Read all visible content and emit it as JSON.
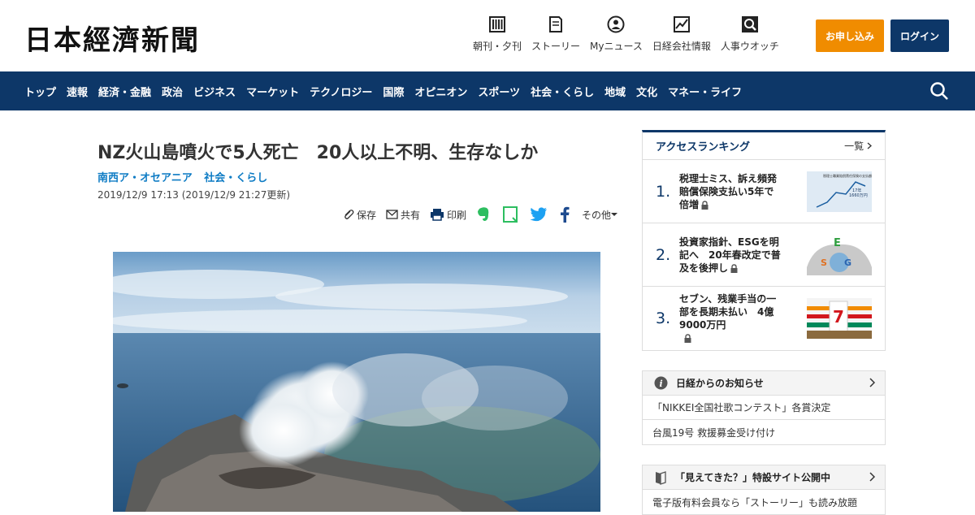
{
  "header": {
    "logo": "日本經濟新聞",
    "nav": [
      {
        "label": "朝刊・夕刊",
        "icon": "newspaper-icon"
      },
      {
        "label": "ストーリー",
        "icon": "book-icon"
      },
      {
        "label": "Myニュース",
        "icon": "user-icon"
      },
      {
        "label": "日経会社情報",
        "icon": "chart-icon"
      },
      {
        "label": "人事ウオッチ",
        "icon": "search-person-icon"
      }
    ],
    "apply_label": "お申し込み",
    "login_label": "ログイン"
  },
  "categories": [
    "トップ",
    "速報",
    "経済・金融",
    "政治",
    "ビジネス",
    "マーケット",
    "テクノロジー",
    "国際",
    "オピニオン",
    "スポーツ",
    "社会・くらし",
    "地域",
    "文化",
    "マネー・ライフ"
  ],
  "article": {
    "title": "NZ火山島噴火で5人死亡　20人以上不明、生存なしか",
    "categories": [
      "南西ア・オセアニア",
      "社会・くらし"
    ],
    "date": "2019/12/9 17:13 (2019/12/9 21:27更新)",
    "tools": {
      "save": "保存",
      "share": "共有",
      "print": "印刷",
      "other": "その他"
    }
  },
  "ranking": {
    "title": "アクセスランキング",
    "more": "一覧",
    "items": [
      {
        "num": "1.",
        "text": "税理士ミス、訴え頻発　賠償保険支払い5年で倍増"
      },
      {
        "num": "2.",
        "text": "投資家指針、ESGを明記へ　20年春改定で普及を後押し"
      },
      {
        "num": "3.",
        "text": "セブン、残業手当の一部を長期未払い　4億9000万円"
      }
    ],
    "thumb1": {
      "title": "税理士職業賠償責任保険の支払額",
      "value": "17年\n1660万円"
    }
  },
  "notice": {
    "title": "日経からのお知らせ",
    "items": [
      "「NIKKEI全国社歌コンテスト」各賞決定",
      "台風19号 救援募金受け付け"
    ]
  },
  "promo": {
    "title": "「見えてきた？」特設サイト公開中",
    "items": [
      "電子版有料会員なら「ストーリー」も読み放題"
    ]
  }
}
